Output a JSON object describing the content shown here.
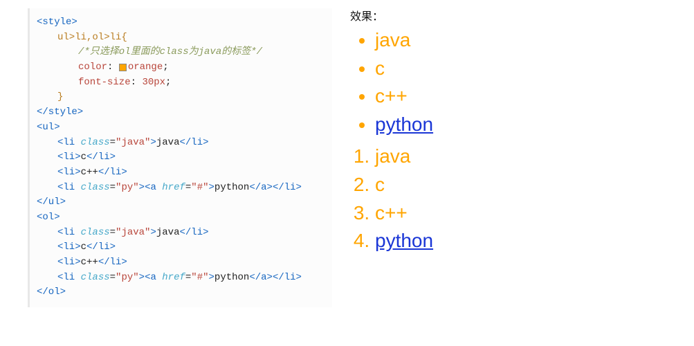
{
  "code": {
    "l1_open": "<style>",
    "l2_sel": "ul>li,ol>li{",
    "l3_comment": "/*只选择ol里面的class为java的标签*/",
    "l4_prop": "color",
    "l4_val": "orange",
    "l5_prop": "font-size",
    "l5_val": "30px",
    "l6_close": "}",
    "l7": "</style>",
    "l8": "<ul>",
    "l9_tag_open": "<li",
    "l9_attr": "class",
    "l9_str": "\"java\"",
    "l9_txt": "java",
    "l9_tag_close": "</li>",
    "l10_open": "<li>",
    "l10_txt": "c",
    "l10_close": "</li>",
    "l11_open": "<li>",
    "l11_txt": "c++",
    "l11_close": "</li>",
    "l12_li_open": "<li",
    "l12_class": "class",
    "l12_class_v": "\"py\"",
    "l12_a_open": "<a",
    "l12_href": "href",
    "l12_href_v": "\"#\"",
    "l12_txt": "python",
    "l12_a_close": "</a>",
    "l12_li_close": "</li>",
    "l13": "</ul>",
    "l14": "<ol>",
    "l15_txt": "java",
    "l16_txt": "c",
    "l17_txt": "c++",
    "l18_txt": "python",
    "l19": "</ol>"
  },
  "result": {
    "label": "效果：",
    "ul": [
      "java",
      "c",
      "c++",
      "python"
    ],
    "ol": [
      "java",
      "c",
      "c++",
      "python"
    ]
  }
}
